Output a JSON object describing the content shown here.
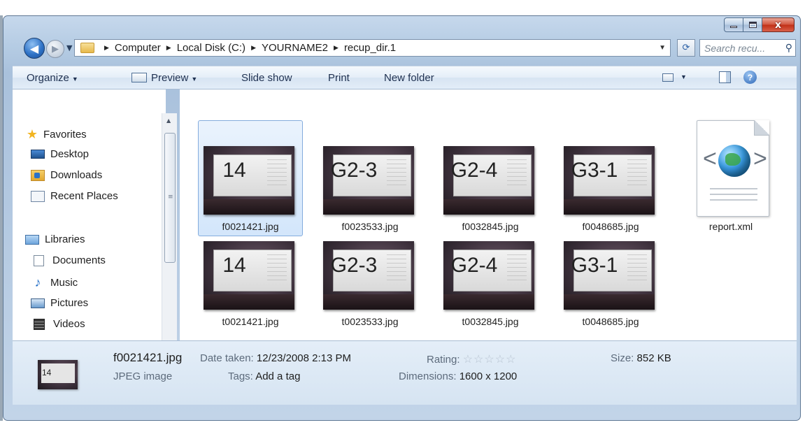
{
  "window": {
    "caption": {
      "minimize": "–",
      "maximize": "□",
      "close": "x"
    }
  },
  "nav": {
    "breadcrumbs": [
      "Computer",
      "Local Disk (C:)",
      "YOURNAME2",
      "recup_dir.1"
    ],
    "search_placeholder": "Search recu..."
  },
  "toolbar": {
    "organize": "Organize",
    "preview": "Preview",
    "slideshow": "Slide show",
    "print": "Print",
    "new_folder": "New folder"
  },
  "sidebar": {
    "favorites": {
      "label": "Favorites",
      "items": [
        {
          "label": "Desktop",
          "icon": "desktop-icon"
        },
        {
          "label": "Downloads",
          "icon": "downloads-icon"
        },
        {
          "label": "Recent Places",
          "icon": "recent-places-icon"
        }
      ]
    },
    "libraries": {
      "label": "Libraries",
      "items": [
        {
          "label": "Documents",
          "icon": "documents-icon"
        },
        {
          "label": "Music",
          "icon": "music-icon"
        },
        {
          "label": "Pictures",
          "icon": "pictures-icon"
        },
        {
          "label": "Videos",
          "icon": "videos-icon"
        }
      ]
    }
  },
  "files": [
    {
      "name": "f0021421.jpg",
      "thumb_text": "14",
      "selected": true
    },
    {
      "name": "f0023533.jpg",
      "thumb_text": "G2-3",
      "selected": false
    },
    {
      "name": "f0032845.jpg",
      "thumb_text": "G2-4",
      "selected": false
    },
    {
      "name": "f0048685.jpg",
      "thumb_text": "G3-1",
      "selected": false
    },
    {
      "name": "report.xml",
      "thumb_text": "",
      "selected": false
    },
    {
      "name": "t0021421.jpg",
      "thumb_text": "14",
      "selected": false
    },
    {
      "name": "t0023533.jpg",
      "thumb_text": "G2-3",
      "selected": false
    },
    {
      "name": "t0032845.jpg",
      "thumb_text": "G2-4",
      "selected": false
    },
    {
      "name": "t0048685.jpg",
      "thumb_text": "G3-1",
      "selected": false
    }
  ],
  "details": {
    "thumb_text": "14",
    "filename": "f0021421.jpg",
    "filetype": "JPEG image",
    "date_taken_label": "Date taken:",
    "date_taken": "12/23/2008 2:13 PM",
    "tags_label": "Tags:",
    "tags": "Add a tag",
    "rating_label": "Rating:",
    "rating_stars": "☆☆☆☆☆",
    "rating_value": 0,
    "dimensions_label": "Dimensions:",
    "dimensions": "1600 x 1200",
    "size_label": "Size:",
    "size": "852 KB"
  },
  "colors": {
    "selection": "#d3e6fb",
    "selection_border": "#84acdd",
    "toolbar_text": "#1e3050",
    "details_key": "#5d6b7c"
  }
}
